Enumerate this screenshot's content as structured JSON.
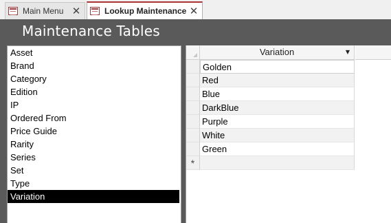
{
  "tabs": [
    {
      "label": "Main Menu",
      "active": false,
      "close_glyph": "✕"
    },
    {
      "label": "Lookup Maintenance",
      "active": true,
      "close_glyph": "✕"
    }
  ],
  "header": {
    "title": "Maintenance Tables"
  },
  "listbox": {
    "items": [
      "Asset",
      "Brand",
      "Category",
      "Edition",
      "IP",
      "Ordered From",
      "Price Guide",
      "Rarity",
      "Series",
      "Set",
      "Type",
      "Variation"
    ],
    "selected": "Variation"
  },
  "datasheet": {
    "column_header": "Variation",
    "rows": [
      "Golden",
      "Red",
      "Blue",
      "DarkBlue",
      "Purple",
      "White",
      "Green"
    ],
    "new_record_marker": "*"
  },
  "colors": {
    "header_bg": "#5a5a5a",
    "selected_bg": "#000000",
    "tab_accent": "#aa3333"
  }
}
